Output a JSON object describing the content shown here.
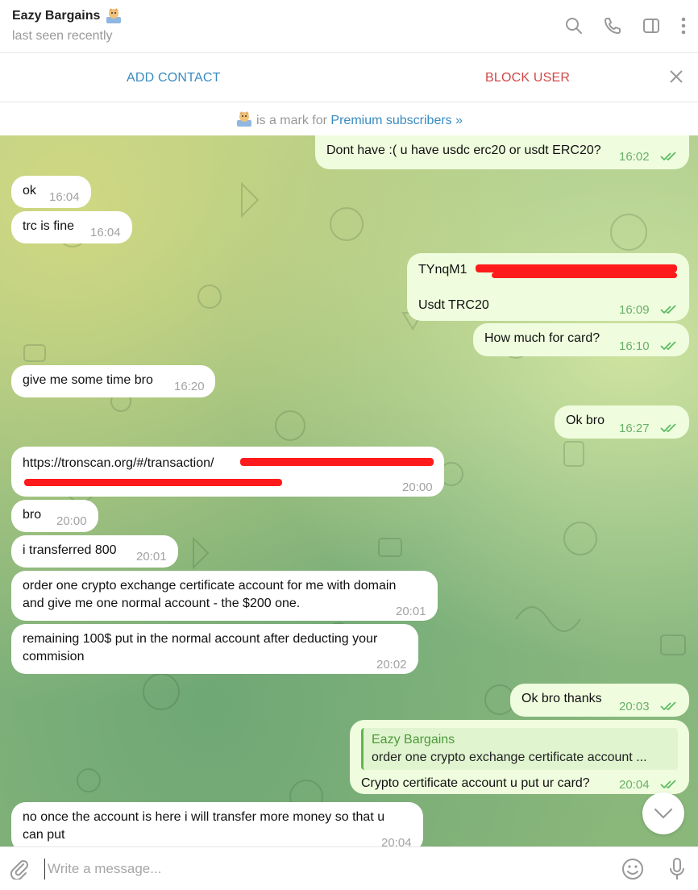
{
  "header": {
    "title": "Eazy Bargains",
    "status": "last seen recently",
    "icons": [
      "search-icon",
      "phone-icon",
      "sidebar-toggle-icon",
      "more-vertical-icon"
    ]
  },
  "actions": {
    "add_contact": "ADD CONTACT",
    "block_user": "BLOCK USER"
  },
  "premium": {
    "text": "is a mark for ",
    "link": "Premium subscribers »"
  },
  "messages": [
    {
      "dir": "out",
      "text": "Dont have :( u have usdc erc20 or usdt ERC20?",
      "time": "16:02"
    },
    {
      "dir": "in",
      "text": "ok",
      "time": "16:04"
    },
    {
      "dir": "in",
      "text": "trc is fine",
      "time": "16:04"
    },
    {
      "dir": "out",
      "text": "TYnqM1",
      "text2": "Usdt TRC20",
      "time": "16:09"
    },
    {
      "dir": "out",
      "text": "How much for card?",
      "time": "16:10"
    },
    {
      "dir": "in",
      "text": "give me some time bro",
      "time": "16:20"
    },
    {
      "dir": "out",
      "text": "Ok bro",
      "time": "16:27"
    },
    {
      "dir": "in",
      "text": "https://tronscan.org/#/transaction/",
      "time": "20:00"
    },
    {
      "dir": "in",
      "text": "bro",
      "time": "20:00"
    },
    {
      "dir": "in",
      "text": "i transferred 800",
      "time": "20:01"
    },
    {
      "dir": "in",
      "text": "order one crypto exchange certificate account for me with domain",
      "text2": "and give me one normal account - the $200 one.",
      "time": "20:01"
    },
    {
      "dir": "in",
      "text": "remaining 100$ put in the normal account after deducting your",
      "text2": "commision",
      "time": "20:02"
    },
    {
      "dir": "out",
      "text": "Ok bro thanks",
      "time": "20:03"
    },
    {
      "dir": "out",
      "reply_author": "Eazy Bargains",
      "reply_text": "order one crypto exchange certificate account ...",
      "text": "Crypto certificate account u put ur card?",
      "time": "20:04"
    },
    {
      "dir": "in",
      "text": "no once the account is here i will transfer more money so that u",
      "text2": "can put",
      "time": "20:04"
    }
  ],
  "composer": {
    "placeholder": "Write a message..."
  },
  "colors": {
    "accent": "#3a8bc0",
    "danger": "#d24646",
    "outgoing_bubble": "#effdde",
    "incoming_bubble": "#ffffff",
    "read_ticks": "#5dbb63"
  }
}
